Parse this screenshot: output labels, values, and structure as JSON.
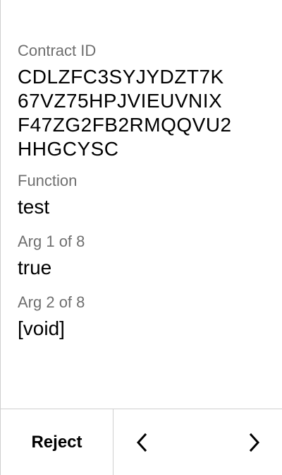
{
  "transaction": {
    "contract_label": "Contract ID",
    "contract_lines": [
      "CDLZFC3SYJYDZT7K",
      "67VZ75HPJVIEUVNIX",
      "F47ZG2FB2RMQQVU2",
      "HHGCYSC"
    ],
    "function_label": "Function",
    "function_value": "test",
    "arg1_label": "Arg 1 of 8",
    "arg1_value": "true",
    "arg2_label": "Arg 2 of 8",
    "arg2_value": "[void]"
  },
  "footer": {
    "reject_label": "Reject",
    "prev_icon": "chevron-left-icon",
    "next_icon": "chevron-right-icon"
  },
  "colors": {
    "label": "#6f6f6f",
    "text": "#000000",
    "divider": "#cfcfcf",
    "background": "#ffffff"
  }
}
